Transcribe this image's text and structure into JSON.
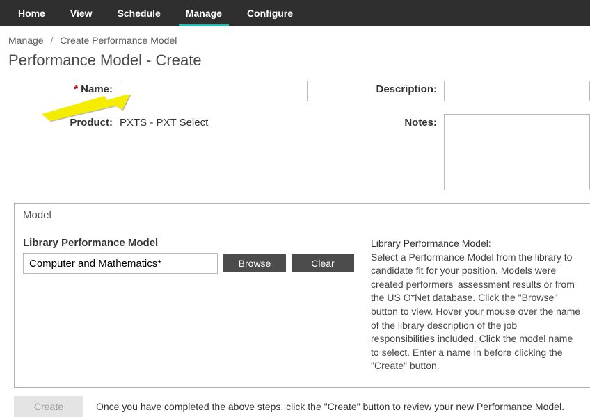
{
  "nav": {
    "items": [
      "Home",
      "View",
      "Schedule",
      "Manage",
      "Configure"
    ],
    "active_index": 3
  },
  "breadcrumb": {
    "parent": "Manage",
    "sep": "/",
    "current": "Create Performance Model"
  },
  "page_title": "Performance Model - Create",
  "form": {
    "name_label": "Name:",
    "name_value": "",
    "product_label": "Product:",
    "product_value": "PXTS - PXT Select",
    "description_label": "Description:",
    "description_value": "",
    "notes_label": "Notes:",
    "notes_value": ""
  },
  "model_panel": {
    "header": "Model",
    "library_label": "Library Performance Model",
    "library_value": "Computer and Mathematics*",
    "browse_label": "Browse",
    "clear_label": "Clear",
    "help_title": "Library Performance Model:",
    "help_text": "Select a Performance Model from the library to candidate fit for your position. Models were created performers' assessment results or from the US O*Net database. Click the \"Browse\" button to view. Hover your mouse over the name of the library description of the job responsibilities included. Click the model name to select. Enter a name in before clicking the \"Create\" button."
  },
  "footer": {
    "create_label": "Create",
    "instruction": "Once you have completed the above steps, click the \"Create\" button to review your new Performance Model."
  }
}
